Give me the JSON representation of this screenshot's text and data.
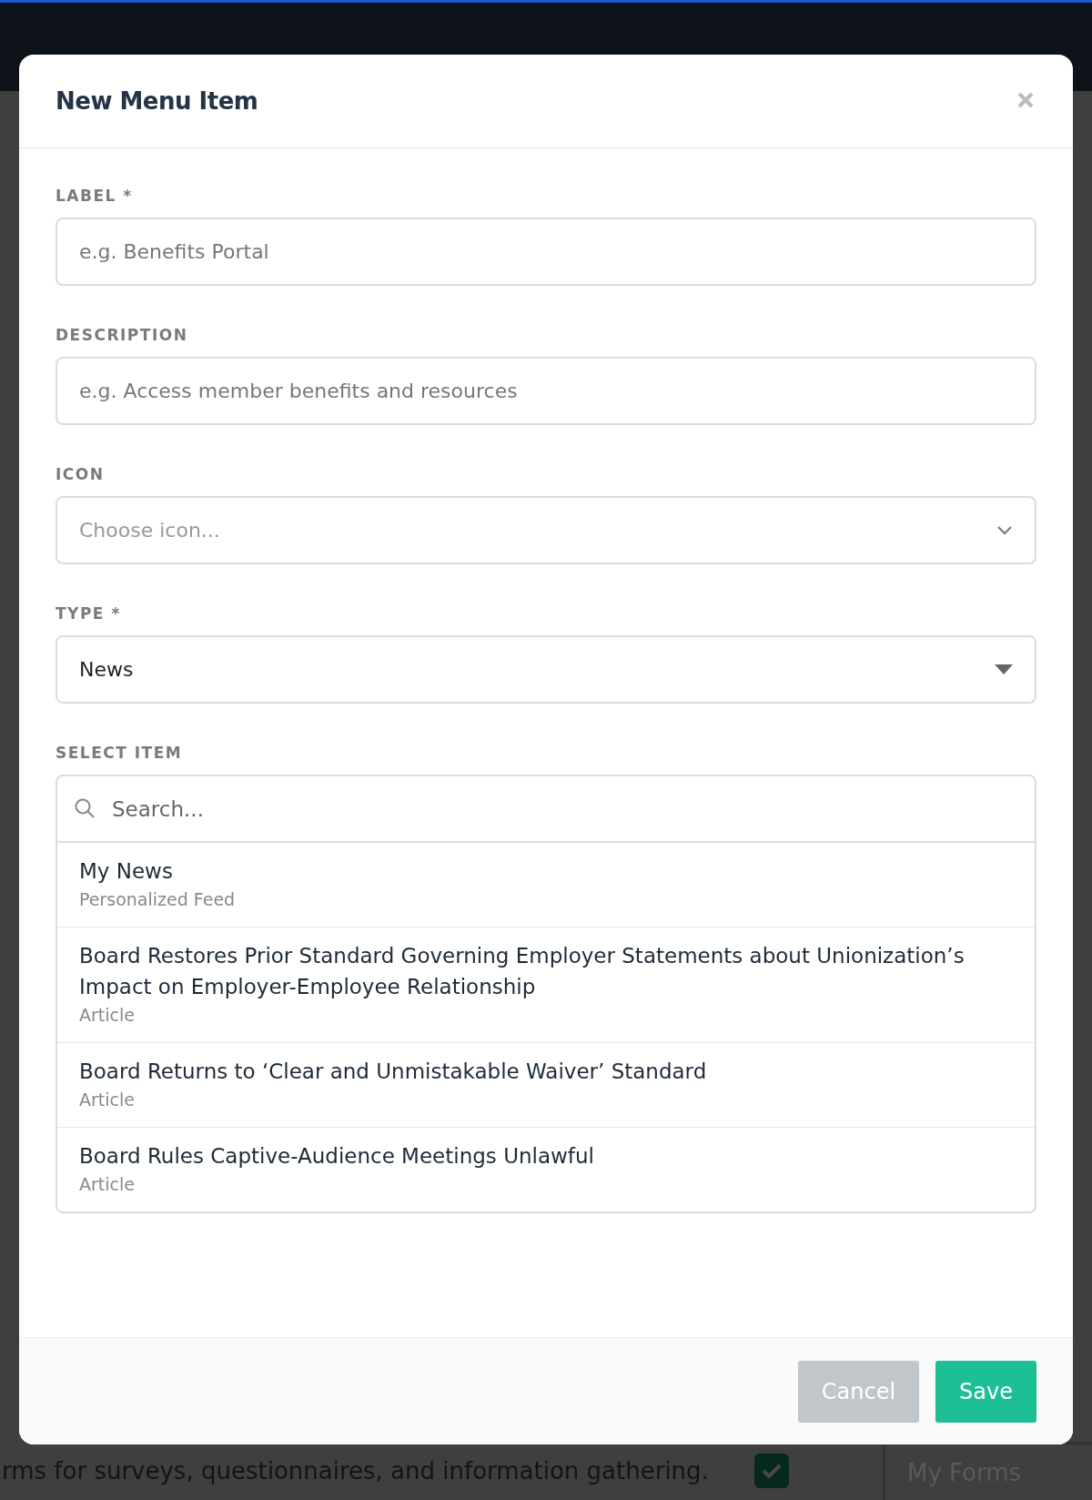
{
  "dialog": {
    "title": "New Menu Item",
    "fields": [
      {
        "kind": "text",
        "label": "LABEL *",
        "placeholder": "e.g. Benefits Portal"
      },
      {
        "kind": "text",
        "label": "DESCRIPTION",
        "placeholder": "e.g. Access member benefits and resources"
      },
      {
        "kind": "select",
        "label": "ICON",
        "placeholder": "Choose icon..."
      },
      {
        "kind": "dropdown",
        "label": "TYPE *",
        "value": "News"
      },
      {
        "kind": "picker",
        "label": "SELECT ITEM",
        "placeholder": "Search...",
        "items": [
          {
            "title": "My News",
            "subtitle": "Personalized Feed"
          },
          {
            "title": "Board Restores Prior Standard Governing Employer Statements about Unionization’s Impact on Employer-Employee Relationship",
            "subtitle": "Article"
          },
          {
            "title": "Board Returns to ‘Clear and Unmistakable Waiver’ Standard",
            "subtitle": "Article"
          },
          {
            "title": "Board Rules Captive-Audience Meetings Unlawful",
            "subtitle": "Article"
          }
        ]
      }
    ],
    "buttons": [
      {
        "kind": "secondary",
        "label": "Cancel"
      },
      {
        "kind": "primary",
        "label": "Save"
      }
    ]
  },
  "background": {
    "description": "rms for surveys, questionnaires, and information gathering.",
    "checked": true,
    "side_label": "My Forms"
  }
}
